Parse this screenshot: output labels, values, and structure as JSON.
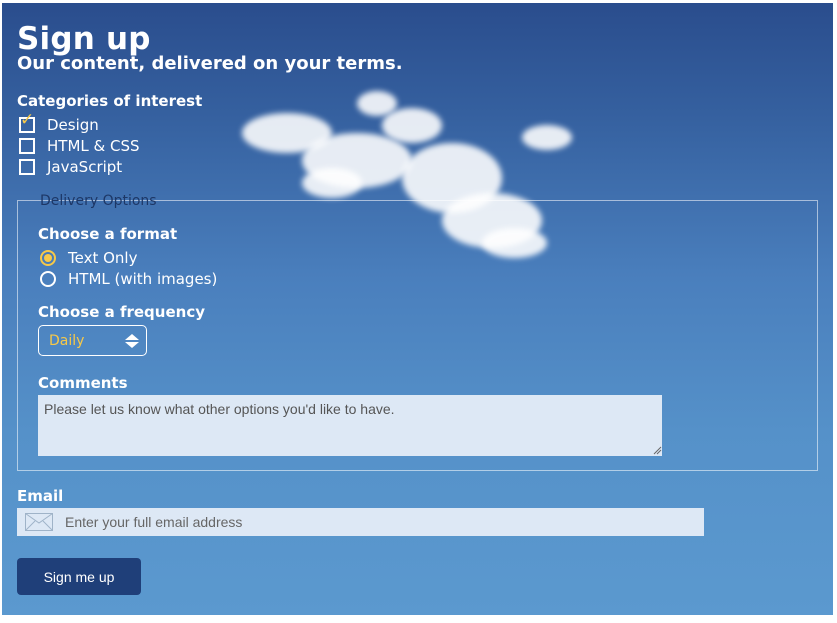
{
  "heading": "Sign up",
  "subheading": "Our content, delivered on your terms.",
  "categories": {
    "label": "Categories of interest",
    "items": [
      {
        "label": "Design",
        "checked": true
      },
      {
        "label": "HTML & CSS",
        "checked": false
      },
      {
        "label": "JavaScript",
        "checked": false
      }
    ]
  },
  "delivery": {
    "legend": "Delivery Options",
    "format_label": "Choose a format",
    "formats": [
      {
        "label": "Text Only",
        "selected": true
      },
      {
        "label": "HTML (with images)",
        "selected": false
      }
    ],
    "frequency_label": "Choose a frequency",
    "frequency_value": "Daily",
    "comments_label": "Comments",
    "comments_placeholder": "Please let us know what other options you'd like to have."
  },
  "email": {
    "label": "Email",
    "placeholder": "Enter your full email address",
    "icon": "envelope-icon"
  },
  "submit_label": "Sign me up",
  "colors": {
    "accent": "#f7c948",
    "button": "#1f3f79",
    "field_bg": "#dde8f5",
    "sky_top": "#2a4d8d",
    "sky_bottom": "#5b99cf"
  }
}
